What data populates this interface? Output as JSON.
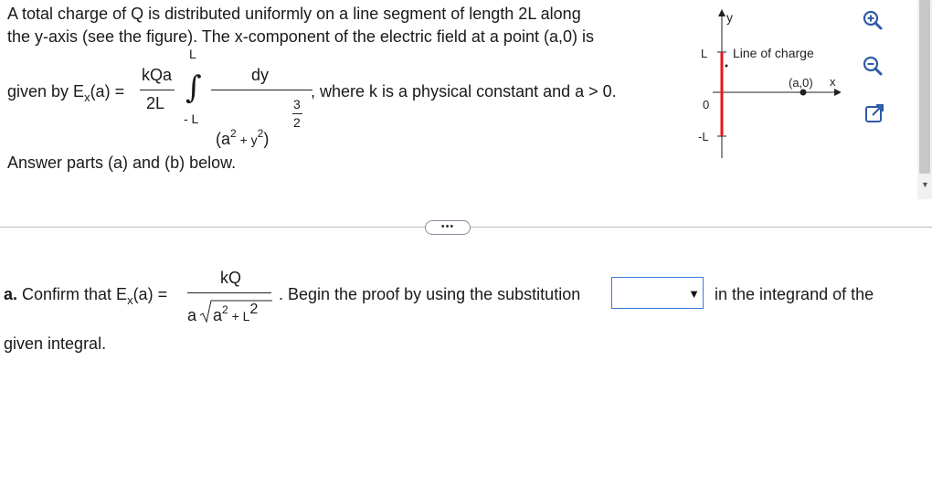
{
  "problem": {
    "line1": "A total charge of Q is distributed uniformly on a line segment of length 2L along",
    "line2": "the y-axis (see the figure). The x-component of the electric field at a point (a,0) is",
    "given_by": "given by E",
    "sub_x": "x",
    "arg": "(a) =",
    "coef_num": "kQa",
    "coef_den": "2L",
    "int_upper": "L",
    "int_lower": "- L",
    "int_symbol": "∫",
    "int_num": "dy",
    "den_base": "(a",
    "den_sq1": "2",
    "den_plus": "+ y",
    "den_sq2": "2",
    "den_close": ")",
    "exp_num": "3",
    "exp_den": "2",
    "where": ", where k is a physical constant and a > 0.",
    "instructions": "Answer parts (a) and (b) below."
  },
  "figure": {
    "y_axis_label": "y",
    "x_axis_label": "x",
    "tick_L": "L",
    "tick_0": "0",
    "tick_negL": "-L",
    "line_label": "Line of charge",
    "point_label": "(a,0)",
    "line_color": "#e8141c"
  },
  "tools": {
    "zoom_in_icon": "zoom-in-icon",
    "zoom_out_icon": "zoom-out-icon",
    "popout_icon": "popout-icon"
  },
  "more_button": "•••",
  "part_a": {
    "label": "a.",
    "confirm": " Confirm that E",
    "sub_x": "x",
    "arg": "(a) =",
    "num": "kQ",
    "den_a": "a",
    "den_radicand_a": "a",
    "den_sq1": "2",
    "den_plus": "+ L",
    "den_sq2": "2",
    "after": ". Begin the proof by using the substitution",
    "dropdown_value": "",
    "tail": "in the integrand of the",
    "line2": "given integral."
  }
}
